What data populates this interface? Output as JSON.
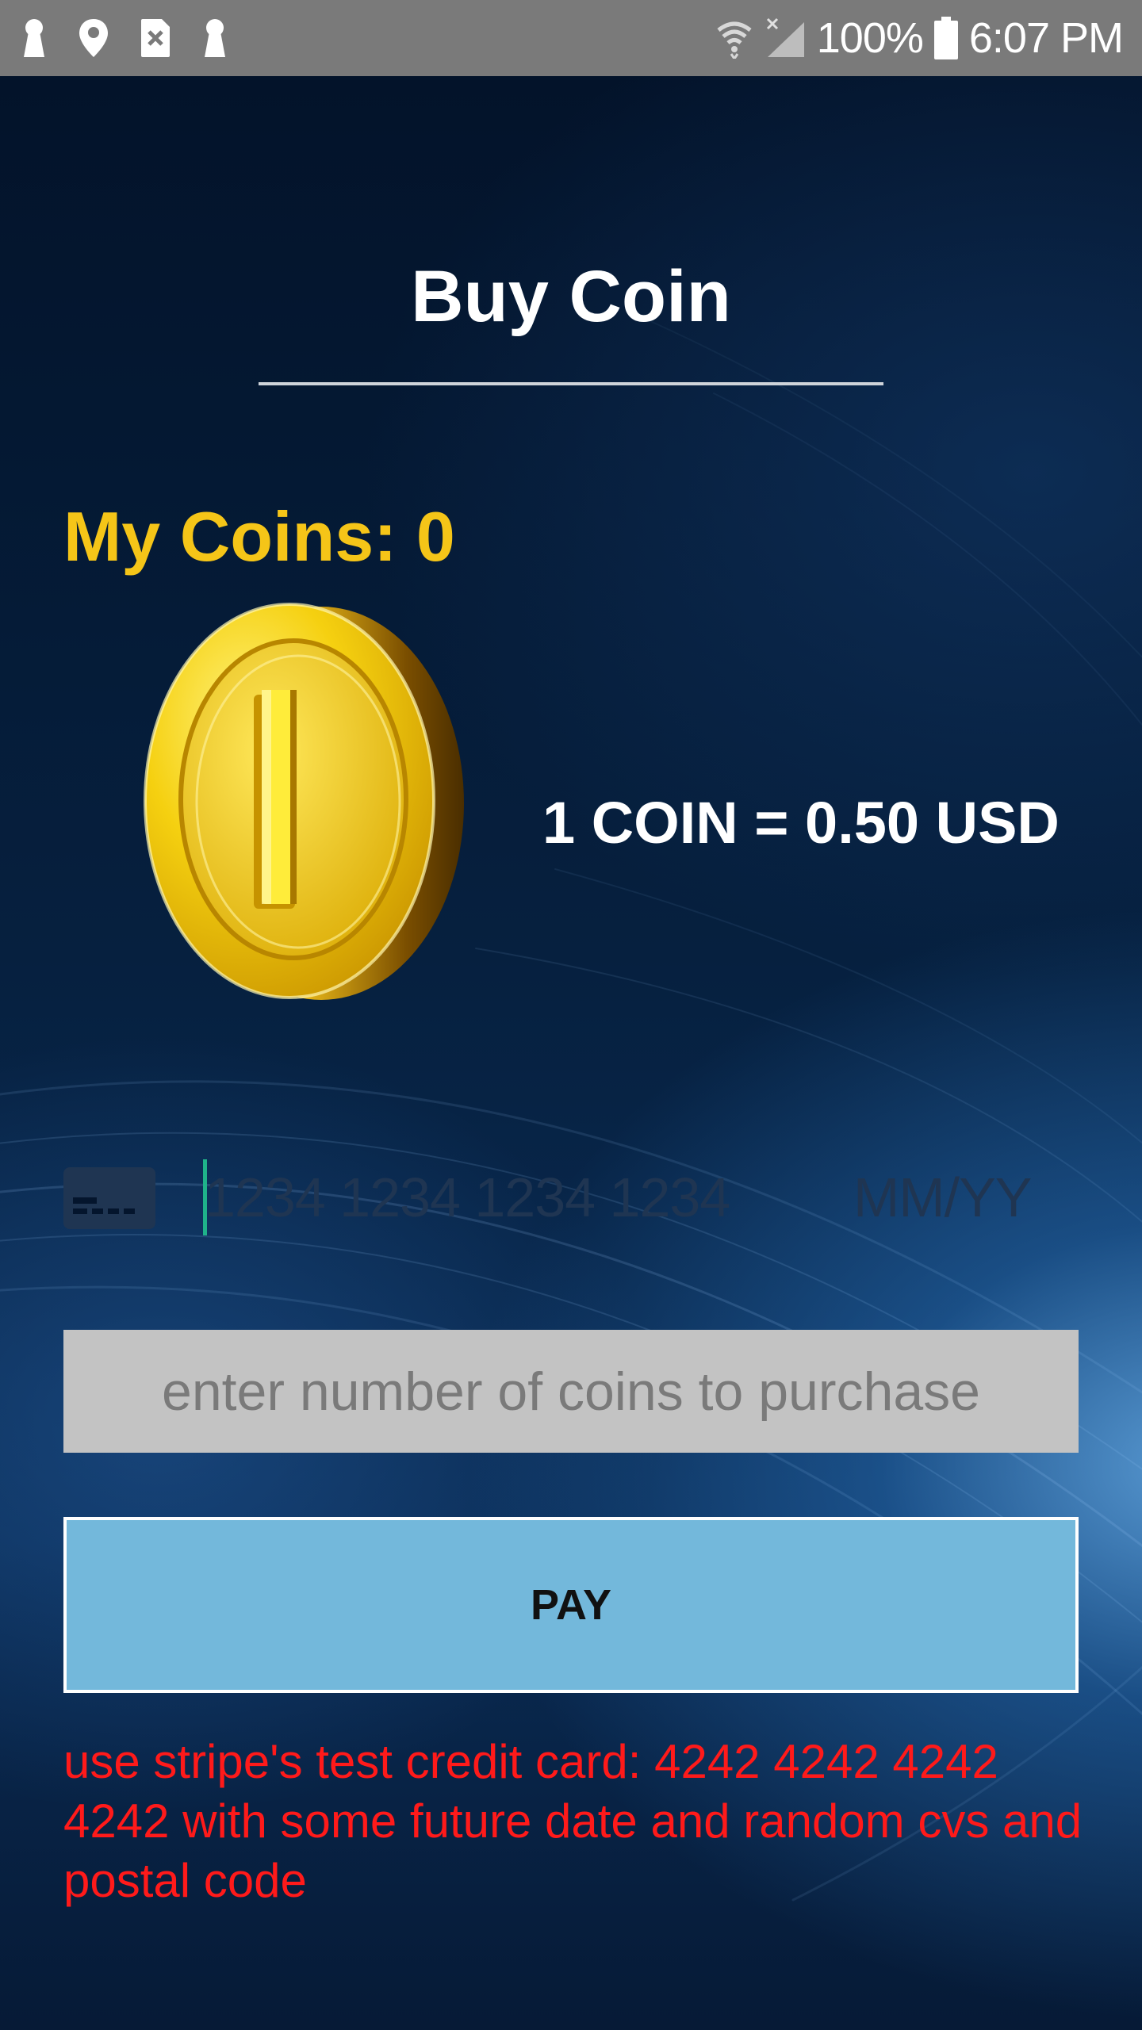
{
  "status_bar": {
    "battery_percent": "100%",
    "time": "6:07 PM",
    "left_icons": [
      "keyhole-icon",
      "location-pin-icon",
      "sim-error-icon",
      "keyhole-icon"
    ],
    "right_icons": [
      "wifi-icon",
      "signal-off-icon",
      "battery-icon"
    ],
    "background_color": "#7a7a7a"
  },
  "page": {
    "title": "Buy Coin",
    "my_coins_label": "My Coins: 0",
    "rate_text": "1 COIN = 0.50 USD",
    "coin_image": "gold-coin-icon"
  },
  "card_input": {
    "icon": "credit-card-icon",
    "number_placeholder": "1234 1234 1234 1234",
    "expiry_placeholder": "MM/YY"
  },
  "coins_input": {
    "placeholder": "enter number of coins to purchase",
    "value": ""
  },
  "pay_button": {
    "label": "PAY"
  },
  "hint": {
    "text": "use stripe's test credit card: 4242 4242 4242 4242 with some future date and random cvs and postal code"
  },
  "colors": {
    "title": "#ffffff",
    "my_coins": "#f5c518",
    "pay_button": "#73b8db",
    "hint": "#ff1a1a",
    "input_bg": "#c3c3c3"
  }
}
